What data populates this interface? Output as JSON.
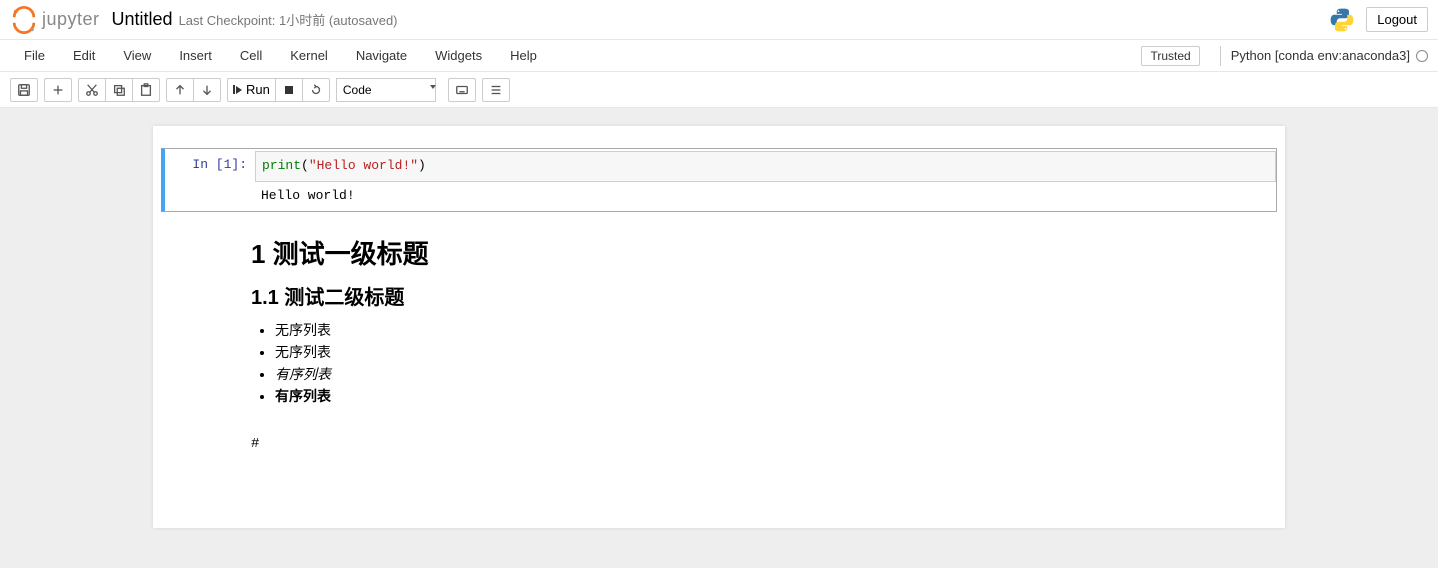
{
  "header": {
    "logo_text": "jupyter",
    "title": "Untitled",
    "checkpoint": "Last Checkpoint: 1小时前   (autosaved)",
    "logout": "Logout"
  },
  "menu": {
    "items": [
      "File",
      "Edit",
      "View",
      "Insert",
      "Cell",
      "Kernel",
      "Navigate",
      "Widgets",
      "Help"
    ],
    "trusted": "Trusted",
    "kernel": "Python [conda env:anaconda3]"
  },
  "toolbar": {
    "run_label": "Run",
    "cell_type": "Code"
  },
  "cells": {
    "code1": {
      "prompt": "In [1]:",
      "code": {
        "fn": "print",
        "paren_l": "(",
        "str": "\"Hello world!\"",
        "paren_r": ")"
      },
      "output": "Hello world!"
    },
    "md": {
      "h1": "1  测试一级标题",
      "h2": "1.1  测试二级标题",
      "li1": "无序列表",
      "li2": "无序列表",
      "li3": "有序列表",
      "li4": "有序列表"
    },
    "stub": "#"
  }
}
